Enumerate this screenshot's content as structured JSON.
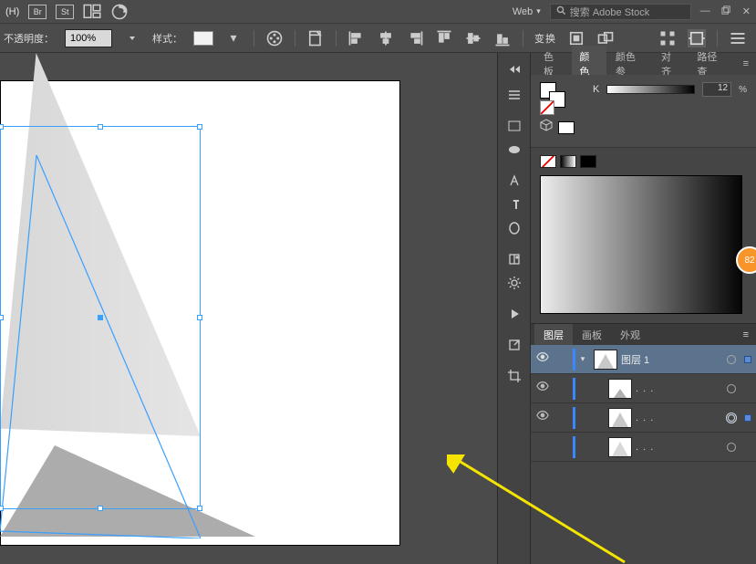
{
  "menubar": {
    "first_item": "(H)",
    "bridge_label": "Br",
    "stock_label": "St",
    "workspace_name": "Web",
    "search_placeholder": "搜索 Adobe Stock"
  },
  "ctrlbar": {
    "opacity_label": "不透明度：",
    "opacity_value": "100%",
    "style_label": "样式：",
    "transform_label": "变换"
  },
  "color_panel": {
    "tabs": {
      "a": "色板",
      "b": "颜色",
      "c": "颜色参",
      "d": "对齐",
      "e": "路径查"
    },
    "k_label": "K",
    "k_value": "12",
    "k_pct": "%"
  },
  "layers_panel": {
    "tabs": {
      "a": "图层",
      "b": "画板",
      "c": "外观"
    },
    "layer1_name": "图层 1",
    "dots": ". . ."
  },
  "badge": {
    "value": "82"
  }
}
